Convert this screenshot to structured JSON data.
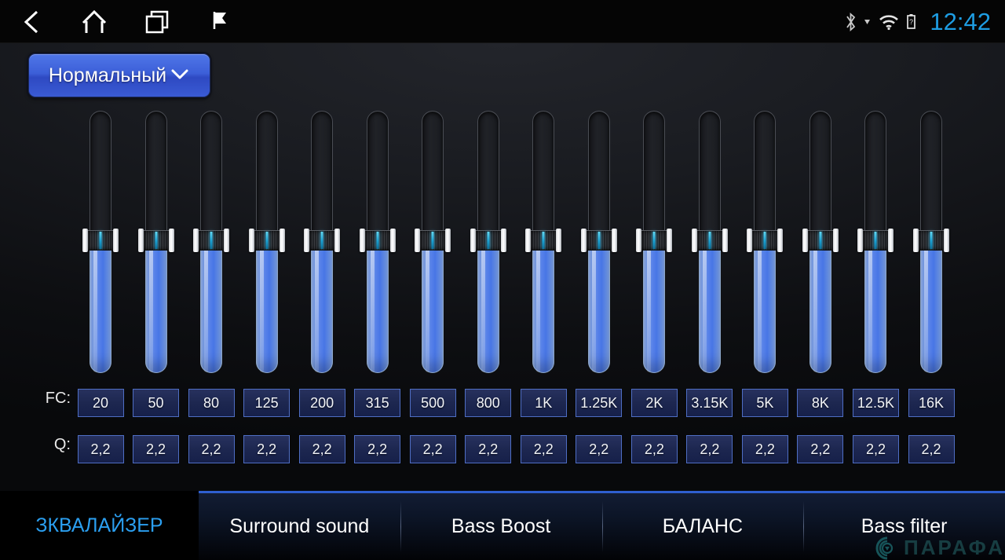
{
  "statusbar": {
    "nav": [
      {
        "name": "back-icon",
        "label": "back"
      },
      {
        "name": "home-icon",
        "label": "home"
      },
      {
        "name": "recents-icon",
        "label": "recents"
      },
      {
        "name": "flag-icon",
        "label": "flag"
      }
    ],
    "icons": [
      {
        "name": "bluetooth-icon",
        "label": "bluetooth"
      },
      {
        "name": "wifi-icon",
        "label": "wifi"
      },
      {
        "name": "battery-icon",
        "label": "battery"
      }
    ],
    "time": "12:42",
    "time_color": "#1e9de3"
  },
  "preset": {
    "label": "Нормальный",
    "chevron": "⌄",
    "accent": "#3c5fd8"
  },
  "equalizer": {
    "fc_row_label": "FC:",
    "q_row_label": "Q:",
    "bands": [
      {
        "fc": "20",
        "q": "2,2",
        "value": 50
      },
      {
        "fc": "50",
        "q": "2,2",
        "value": 50
      },
      {
        "fc": "80",
        "q": "2,2",
        "value": 50
      },
      {
        "fc": "125",
        "q": "2,2",
        "value": 50
      },
      {
        "fc": "200",
        "q": "2,2",
        "value": 50
      },
      {
        "fc": "315",
        "q": "2,2",
        "value": 50
      },
      {
        "fc": "500",
        "q": "2,2",
        "value": 50
      },
      {
        "fc": "800",
        "q": "2,2",
        "value": 50
      },
      {
        "fc": "1K",
        "q": "2,2",
        "value": 50
      },
      {
        "fc": "1.25K",
        "q": "2,2",
        "value": 50
      },
      {
        "fc": "2K",
        "q": "2,2",
        "value": 50
      },
      {
        "fc": "3.15K",
        "q": "2,2",
        "value": 50
      },
      {
        "fc": "5K",
        "q": "2,2",
        "value": 50
      },
      {
        "fc": "8K",
        "q": "2,2",
        "value": 50
      },
      {
        "fc": "12.5K",
        "q": "2,2",
        "value": 50
      },
      {
        "fc": "16K",
        "q": "2,2",
        "value": 50
      }
    ],
    "fill_color": "#5b86ef"
  },
  "tabs": [
    {
      "label": "ЗКВАЛАЙЗЕР",
      "active": true
    },
    {
      "label": "Surround sound",
      "active": false
    },
    {
      "label": "Bass Boost",
      "active": false
    },
    {
      "label": "БАЛАНС",
      "active": false
    },
    {
      "label": "Bass filter",
      "active": false
    }
  ],
  "watermark": {
    "text": "ПАРАФА",
    "color": "#1d4f52"
  }
}
